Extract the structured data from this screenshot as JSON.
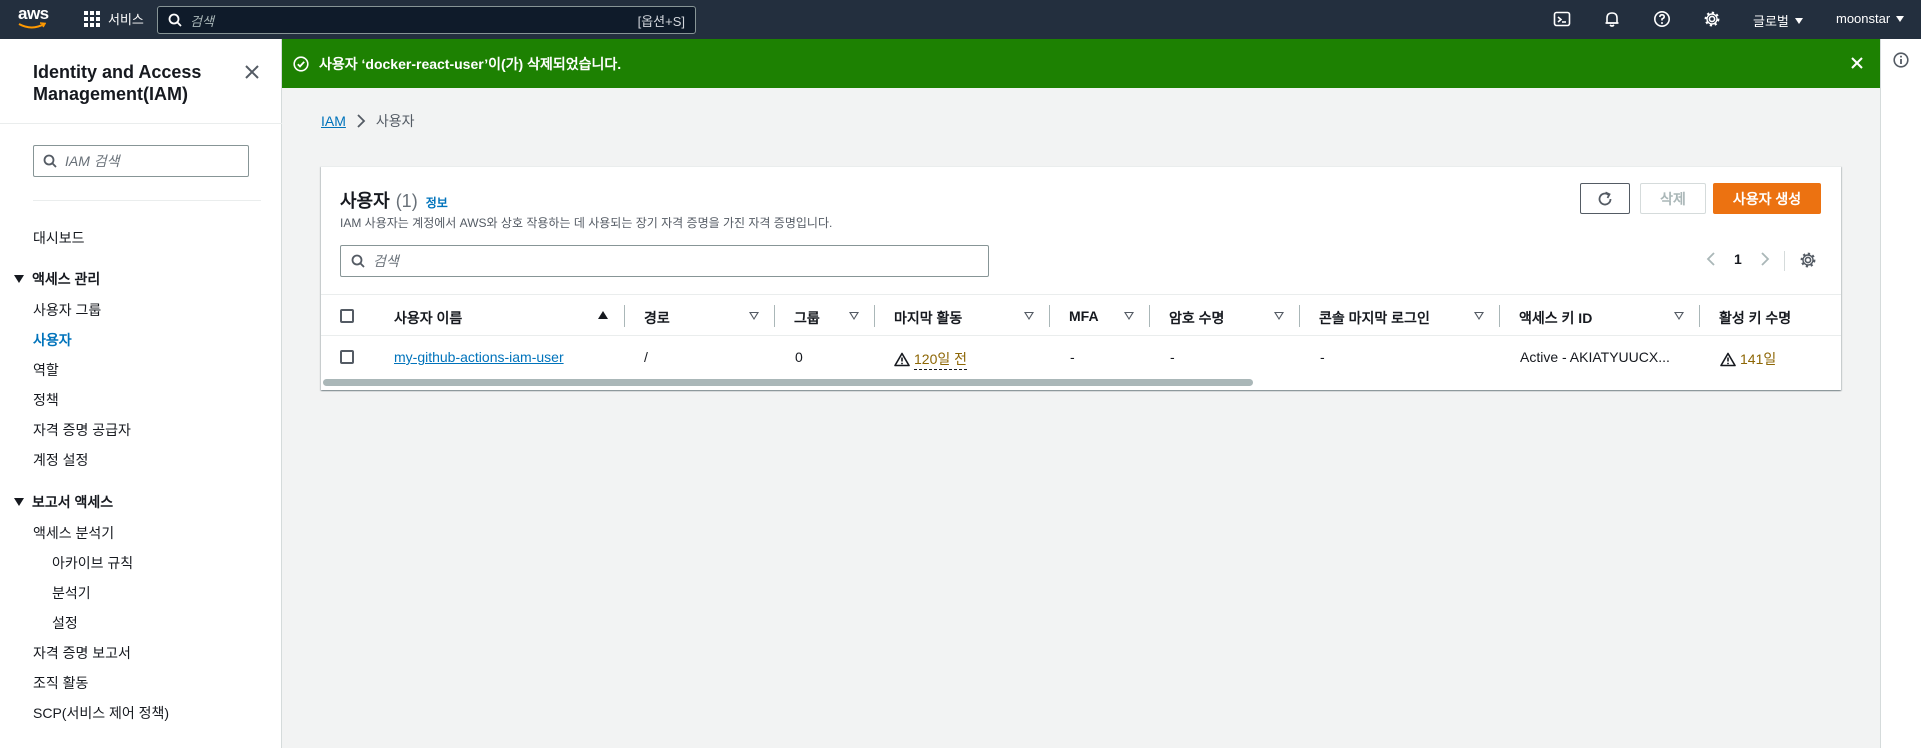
{
  "topnav": {
    "logo_text": "aws",
    "services_label": "서비스",
    "search_placeholder": "검색",
    "search_shortcut": "[옵션+S]",
    "region_label": "글로벌",
    "account_label": "moonstar",
    "icons": [
      "cloudshell-icon",
      "bell-icon",
      "help-icon",
      "settings-icon"
    ]
  },
  "sidebar": {
    "title": "Identity and Access Management(IAM)",
    "search_placeholder": "IAM 검색",
    "dashboard": "대시보드",
    "section_access": "액세스 관리",
    "access_items": [
      "사용자 그룹",
      "사용자",
      "역할",
      "정책",
      "자격 증명 공급자",
      "계정 설정"
    ],
    "active_item": "사용자",
    "section_reports": "보고서 액세스",
    "analyzer": "액세스 분석기",
    "analyzer_items": [
      "아카이브 규칙",
      "분석기",
      "설정"
    ],
    "report_items": [
      "자격 증명 보고서",
      "조직 활동",
      "SCP(서비스 제어 정책)"
    ]
  },
  "flash": {
    "message": "사용자 ‘docker-react-user’이(가) 삭제되었습니다.",
    "color": "#1d8102"
  },
  "breadcrumb": {
    "root": "IAM",
    "current": "사용자"
  },
  "users": {
    "title": "사용자",
    "count": "(1)",
    "info": "정보",
    "description": "IAM 사용자는 계정에서 AWS와 상호 작용하는 데 사용되는 장기 자격 증명을 가진 자격 증명입니다.",
    "delete_label": "삭제",
    "create_label": "사용자 생성",
    "search_placeholder": "검색",
    "page": "1",
    "columns": [
      "사용자 이름",
      "경로",
      "그룹",
      "마지막 활동",
      "MFA",
      "암호 수명",
      "콘솔 마지막 로그인",
      "액세스 키 ID",
      "활성 키 수명"
    ],
    "rows": [
      {
        "username": "my-github-actions-iam-user",
        "path": "/",
        "groups": "0",
        "last_activity": "120일 전",
        "mfa": "-",
        "password_age": "-",
        "console_last_login": "-",
        "access_key_id": "Active - AKIATYUUCX...",
        "active_key_age": "141일"
      }
    ],
    "accent_color": "#ec7211",
    "link_color": "#0073bb",
    "warning_color": "#8d6605"
  }
}
